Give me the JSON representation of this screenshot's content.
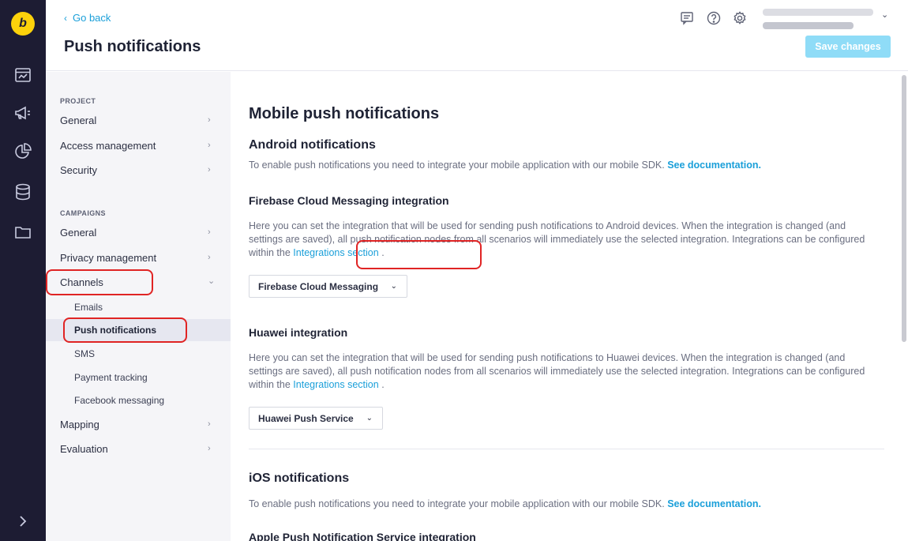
{
  "rail": {
    "logo_letter": "b",
    "icons": [
      "logo-icon",
      "dashboard-icon",
      "megaphone-icon",
      "pie-chart-icon",
      "database-icon",
      "folder-icon"
    ],
    "expand_icon": "chevron-right-icon"
  },
  "header": {
    "go_back": "Go back",
    "title": "Push notifications",
    "icons": [
      "chat-icon",
      "help-icon",
      "settings-icon"
    ],
    "save_label": "Save changes"
  },
  "sidebar": {
    "section_project": "PROJECT",
    "project_items": [
      {
        "label": "General"
      },
      {
        "label": "Access management"
      },
      {
        "label": "Security"
      }
    ],
    "section_campaigns": "CAMPAIGNS",
    "campaign_items": [
      {
        "label": "General"
      },
      {
        "label": "Privacy management"
      },
      {
        "label": "Channels"
      }
    ],
    "channel_subitems": [
      {
        "label": "Emails"
      },
      {
        "label": "Push notifications"
      },
      {
        "label": "SMS"
      },
      {
        "label": "Payment tracking"
      },
      {
        "label": "Facebook messaging"
      }
    ],
    "more_items": [
      {
        "label": "Mapping"
      },
      {
        "label": "Evaluation"
      }
    ]
  },
  "main": {
    "heading": "Mobile push notifications",
    "android": {
      "title": "Android notifications",
      "intro_text": "To enable push notifications you need to integrate your mobile application with our mobile SDK.",
      "intro_link": "See documentation."
    },
    "firebase": {
      "title": "Firebase Cloud Messaging integration",
      "text": "Here you can set the integration that will be used for sending push notifications to Android devices. When the integration is changed (and settings are saved), all push notification nodes from all scenarios will immediately use the selected integration. Integrations can be configured within the",
      "link": "Integrations section",
      "suffix": ".",
      "selected": "Firebase Cloud Messaging"
    },
    "huawei": {
      "title": "Huawei integration",
      "text": "Here you can set the integration that will be used for sending push notifications to Huawei devices. When the integration is changed (and settings are saved), all push notification nodes from all scenarios will immediately use the selected integration. Integrations can be configured within the",
      "link": "Integrations section",
      "suffix": ".",
      "selected": "Huawei Push Service"
    },
    "ios": {
      "title": "iOS notifications",
      "intro_text": "To enable push notifications you need to integrate your mobile application with our mobile SDK.",
      "intro_link": "See documentation."
    },
    "apns": {
      "title": "Apple Push Notification Service integration"
    }
  },
  "colors": {
    "rail_bg": "#1d1c33",
    "brand_yellow": "#fdd20b",
    "accent_blue": "#1a9fd9",
    "save_button_disabled": "#8fdcf7",
    "annotation_red": "#e02424"
  }
}
